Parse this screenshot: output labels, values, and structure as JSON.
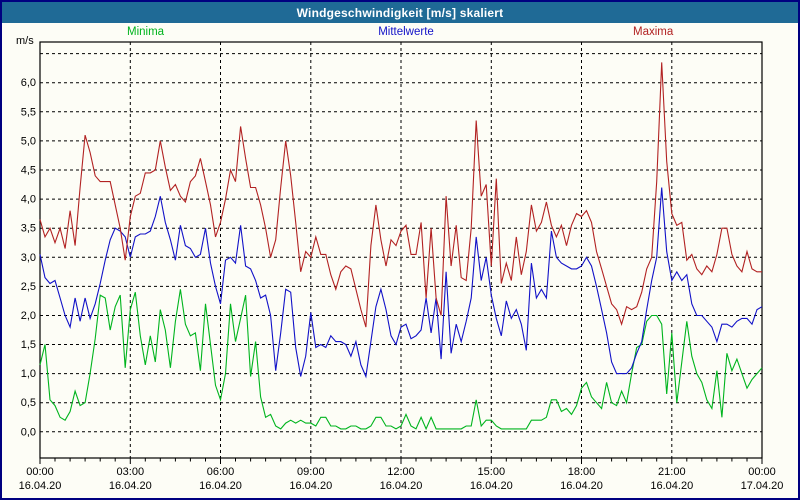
{
  "colors": {
    "titlebar_bg": "#1f6a96",
    "window_border": "#000080",
    "grid": "#000000",
    "minima": "#00b41e",
    "mittelwerte": "#1212c8",
    "maxima": "#b22222"
  },
  "chart_data": {
    "type": "line",
    "title": "Windgeschwindigkeit [m/s] skaliert",
    "ylabel": "m/s",
    "ylim": [
      0,
      6.5
    ],
    "grid": "dashed",
    "legend_position": "top",
    "sample_interval_minutes": 10,
    "x_minor_tick_minutes": 30,
    "y_ticks": [
      {
        "value": 6.0,
        "label": "6,0"
      },
      {
        "value": 5.5,
        "label": "5,5"
      },
      {
        "value": 5.0,
        "label": "5,0"
      },
      {
        "value": 4.5,
        "label": "4,5"
      },
      {
        "value": 4.0,
        "label": "4,0"
      },
      {
        "value": 3.5,
        "label": "3,5"
      },
      {
        "value": 3.0,
        "label": "3,0"
      },
      {
        "value": 2.5,
        "label": "2,5"
      },
      {
        "value": 2.0,
        "label": "2,0"
      },
      {
        "value": 1.5,
        "label": "1,5"
      },
      {
        "value": 1.0,
        "label": "1,0"
      },
      {
        "value": 0.5,
        "label": "0,5"
      },
      {
        "value": 0.0,
        "label": "0,0"
      }
    ],
    "x_ticks": [
      {
        "hour": 0,
        "time": "00:00",
        "date": "16.04.20"
      },
      {
        "hour": 3,
        "time": "03:00",
        "date": "16.04.20"
      },
      {
        "hour": 6,
        "time": "06:00",
        "date": "16.04.20"
      },
      {
        "hour": 9,
        "time": "09:00",
        "date": "16.04.20"
      },
      {
        "hour": 12,
        "time": "12:00",
        "date": "16.04.20"
      },
      {
        "hour": 15,
        "time": "15:00",
        "date": "16.04.20"
      },
      {
        "hour": 18,
        "time": "18:00",
        "date": "16.04.20"
      },
      {
        "hour": 21,
        "time": "21:00",
        "date": "16.04.20"
      },
      {
        "hour": 24,
        "time": "00:00",
        "date": "17.04.20"
      }
    ],
    "series": [
      {
        "name": "Minima",
        "color": "#00b41e",
        "values": [
          1.15,
          1.5,
          0.55,
          0.45,
          0.25,
          0.2,
          0.35,
          0.7,
          0.45,
          0.5,
          1.0,
          1.6,
          2.35,
          2.3,
          1.75,
          2.15,
          2.35,
          1.1,
          2.1,
          2.4,
          1.65,
          1.15,
          1.65,
          1.2,
          2.1,
          1.75,
          1.1,
          1.9,
          2.45,
          1.85,
          1.65,
          1.7,
          1.05,
          2.2,
          1.5,
          0.8,
          0.55,
          1.0,
          2.2,
          1.55,
          1.95,
          2.35,
          0.95,
          1.55,
          0.6,
          0.25,
          0.3,
          0.1,
          0.05,
          0.15,
          0.2,
          0.15,
          0.2,
          0.15,
          0.15,
          0.1,
          0.25,
          0.25,
          0.1,
          0.1,
          0.05,
          0.05,
          0.1,
          0.1,
          0.05,
          0.05,
          0.1,
          0.25,
          0.25,
          0.1,
          0.1,
          0.05,
          0.1,
          0.3,
          0.1,
          0.05,
          0.25,
          0.05,
          0.25,
          0.05,
          0.05,
          0.05,
          0.05,
          0.05,
          0.05,
          0.1,
          0.1,
          0.55,
          0.1,
          0.2,
          0.2,
          0.1,
          0.05,
          0.05,
          0.05,
          0.05,
          0.05,
          0.05,
          0.2,
          0.2,
          0.2,
          0.25,
          0.55,
          0.55,
          0.35,
          0.4,
          0.3,
          0.45,
          0.75,
          0.85,
          0.6,
          0.5,
          0.4,
          0.85,
          0.5,
          0.45,
          0.7,
          0.5,
          1.0,
          1.45,
          1.5,
          1.9,
          2.0,
          2.0,
          1.85,
          0.65,
          1.7,
          0.5,
          1.2,
          1.9,
          1.3,
          1.0,
          0.85,
          0.55,
          0.4,
          1.05,
          0.25,
          1.35,
          1.05,
          1.25,
          1.0,
          0.75,
          0.9,
          1.0,
          1.1
        ]
      },
      {
        "name": "Mittelwerte",
        "color": "#1212c8",
        "values": [
          3.05,
          2.65,
          2.55,
          2.6,
          2.3,
          2.0,
          1.8,
          2.3,
          1.9,
          2.3,
          1.95,
          2.2,
          2.55,
          2.95,
          3.3,
          3.5,
          3.45,
          3.35,
          3.0,
          3.35,
          3.4,
          3.4,
          3.45,
          3.7,
          4.05,
          3.6,
          3.3,
          2.95,
          3.55,
          3.2,
          3.15,
          3.0,
          3.05,
          3.5,
          2.9,
          2.5,
          2.2,
          2.95,
          3.0,
          2.9,
          3.55,
          2.85,
          2.8,
          2.6,
          2.3,
          2.35,
          2.0,
          1.05,
          1.7,
          2.45,
          2.4,
          1.45,
          0.95,
          1.3,
          2.05,
          1.45,
          1.5,
          1.45,
          1.65,
          1.55,
          1.55,
          1.5,
          1.3,
          1.55,
          1.15,
          0.95,
          1.55,
          2.15,
          2.45,
          2.1,
          1.65,
          1.5,
          1.8,
          1.85,
          1.6,
          1.65,
          1.75,
          2.3,
          1.7,
          2.3,
          1.25,
          2.75,
          1.35,
          1.85,
          1.55,
          1.9,
          2.3,
          3.35,
          2.6,
          3.0,
          2.35,
          1.95,
          1.65,
          2.25,
          1.95,
          2.1,
          1.85,
          1.4,
          2.9,
          2.3,
          2.45,
          2.3,
          3.45,
          3.0,
          2.9,
          2.85,
          2.8,
          2.8,
          2.85,
          3.0,
          2.85,
          2.5,
          2.1,
          1.7,
          1.2,
          1.0,
          1.0,
          1.0,
          1.1,
          1.35,
          1.55,
          2.1,
          2.6,
          3.0,
          4.2,
          3.1,
          2.6,
          2.75,
          2.6,
          2.7,
          2.2,
          2.0,
          2.0,
          1.9,
          1.8,
          1.55,
          1.85,
          1.85,
          1.8,
          1.9,
          1.95,
          1.95,
          1.85,
          2.1,
          2.15
        ]
      },
      {
        "name": "Maxima",
        "color": "#b22222",
        "values": [
          3.65,
          3.35,
          3.5,
          3.25,
          3.5,
          3.15,
          3.8,
          3.2,
          4.2,
          5.1,
          4.8,
          4.4,
          4.3,
          4.3,
          4.3,
          3.9,
          3.5,
          2.95,
          3.7,
          4.05,
          4.1,
          4.45,
          4.45,
          4.5,
          5.0,
          4.55,
          4.15,
          4.25,
          4.05,
          3.95,
          4.3,
          4.4,
          4.7,
          4.3,
          3.9,
          3.35,
          3.6,
          4.0,
          4.5,
          4.3,
          5.25,
          4.7,
          4.2,
          4.2,
          3.9,
          3.5,
          3.0,
          3.3,
          4.2,
          5.0,
          4.4,
          3.6,
          2.75,
          3.1,
          3.0,
          3.35,
          3.05,
          3.05,
          2.7,
          2.45,
          2.75,
          2.85,
          2.8,
          2.45,
          2.1,
          1.8,
          3.2,
          3.9,
          3.3,
          2.85,
          3.3,
          3.2,
          3.45,
          3.55,
          3.05,
          3.05,
          3.6,
          2.3,
          3.5,
          2.3,
          2.0,
          4.05,
          2.85,
          3.55,
          2.65,
          2.6,
          3.5,
          5.35,
          4.05,
          4.25,
          2.85,
          4.35,
          2.55,
          2.9,
          2.6,
          3.35,
          2.7,
          3.1,
          3.9,
          3.45,
          3.6,
          3.95,
          3.55,
          3.35,
          3.55,
          3.2,
          3.55,
          3.75,
          3.7,
          3.8,
          3.6,
          3.1,
          2.8,
          2.5,
          2.2,
          2.1,
          1.85,
          2.15,
          2.1,
          2.15,
          2.4,
          2.8,
          3.0,
          4.3,
          6.35,
          4.65,
          3.75,
          3.55,
          3.6,
          2.95,
          3.05,
          2.8,
          2.7,
          2.85,
          2.75,
          3.05,
          3.5,
          3.5,
          3.05,
          2.85,
          2.75,
          3.1,
          2.8,
          2.75,
          2.75
        ]
      }
    ]
  }
}
